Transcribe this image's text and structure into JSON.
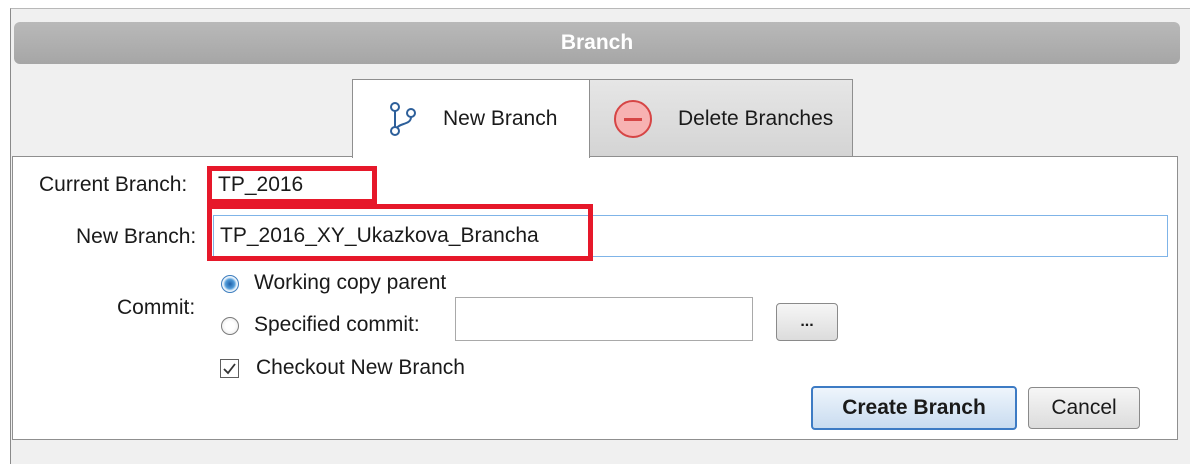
{
  "window": {
    "title": "Branch"
  },
  "tabs": {
    "new_branch": {
      "label": "New Branch",
      "icon": "branch-icon"
    },
    "delete_branches": {
      "label": "Delete Branches",
      "icon": "minus-circle-icon"
    }
  },
  "form": {
    "current_branch_label": "Current Branch:",
    "current_branch_value": "TP_2016",
    "new_branch_label": "New Branch:",
    "new_branch_value": "TP_2016_XY_Ukazkova_Brancha",
    "commit_label": "Commit:",
    "commit_options": {
      "working_copy": "Working copy parent",
      "specified": "Specified commit:"
    },
    "selected_commit_option": "Working copy parent",
    "specified_commit_value": "",
    "browse_label": "...",
    "checkout_label": "Checkout New Branch",
    "checkout_checked": true
  },
  "buttons": {
    "create": "Create Branch",
    "cancel": "Cancel"
  },
  "colors": {
    "highlight": "#e6182a",
    "accent": "#3d7bc4",
    "title_bar": "#b0b0b0"
  }
}
